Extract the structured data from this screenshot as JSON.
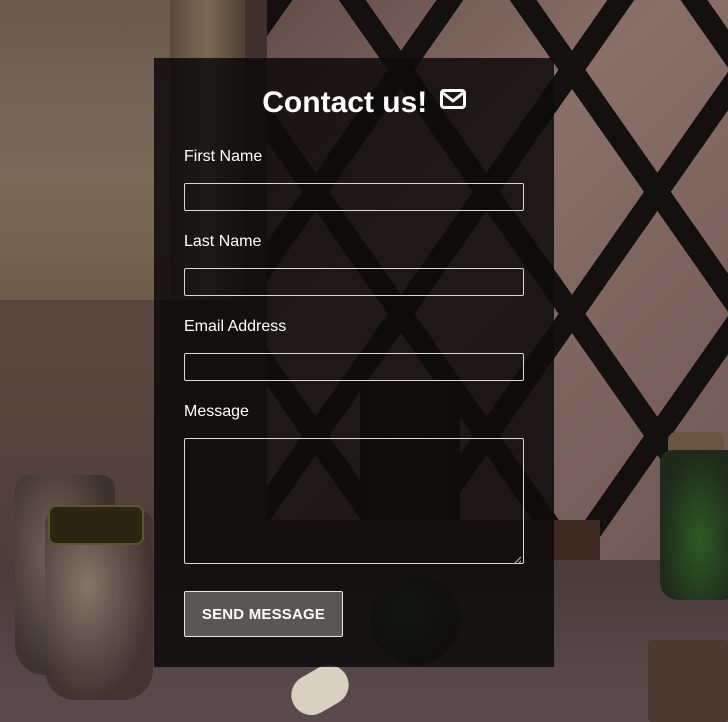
{
  "form": {
    "title": "Contact us!",
    "icon": "envelope-icon",
    "fields": {
      "first_name": {
        "label": "First Name",
        "value": "",
        "placeholder": ""
      },
      "last_name": {
        "label": "Last Name",
        "value": "",
        "placeholder": ""
      },
      "email": {
        "label": "Email Address",
        "value": "",
        "placeholder": ""
      },
      "message": {
        "label": "Message",
        "value": "",
        "placeholder": ""
      }
    },
    "submit_label": "SEND MESSAGE"
  },
  "colors": {
    "panel_background": "#0d0a0a",
    "text": "#ffffff",
    "input_border": "#d8d8d8",
    "button_background": "#5a5655",
    "button_border": "#e6e6e6"
  }
}
